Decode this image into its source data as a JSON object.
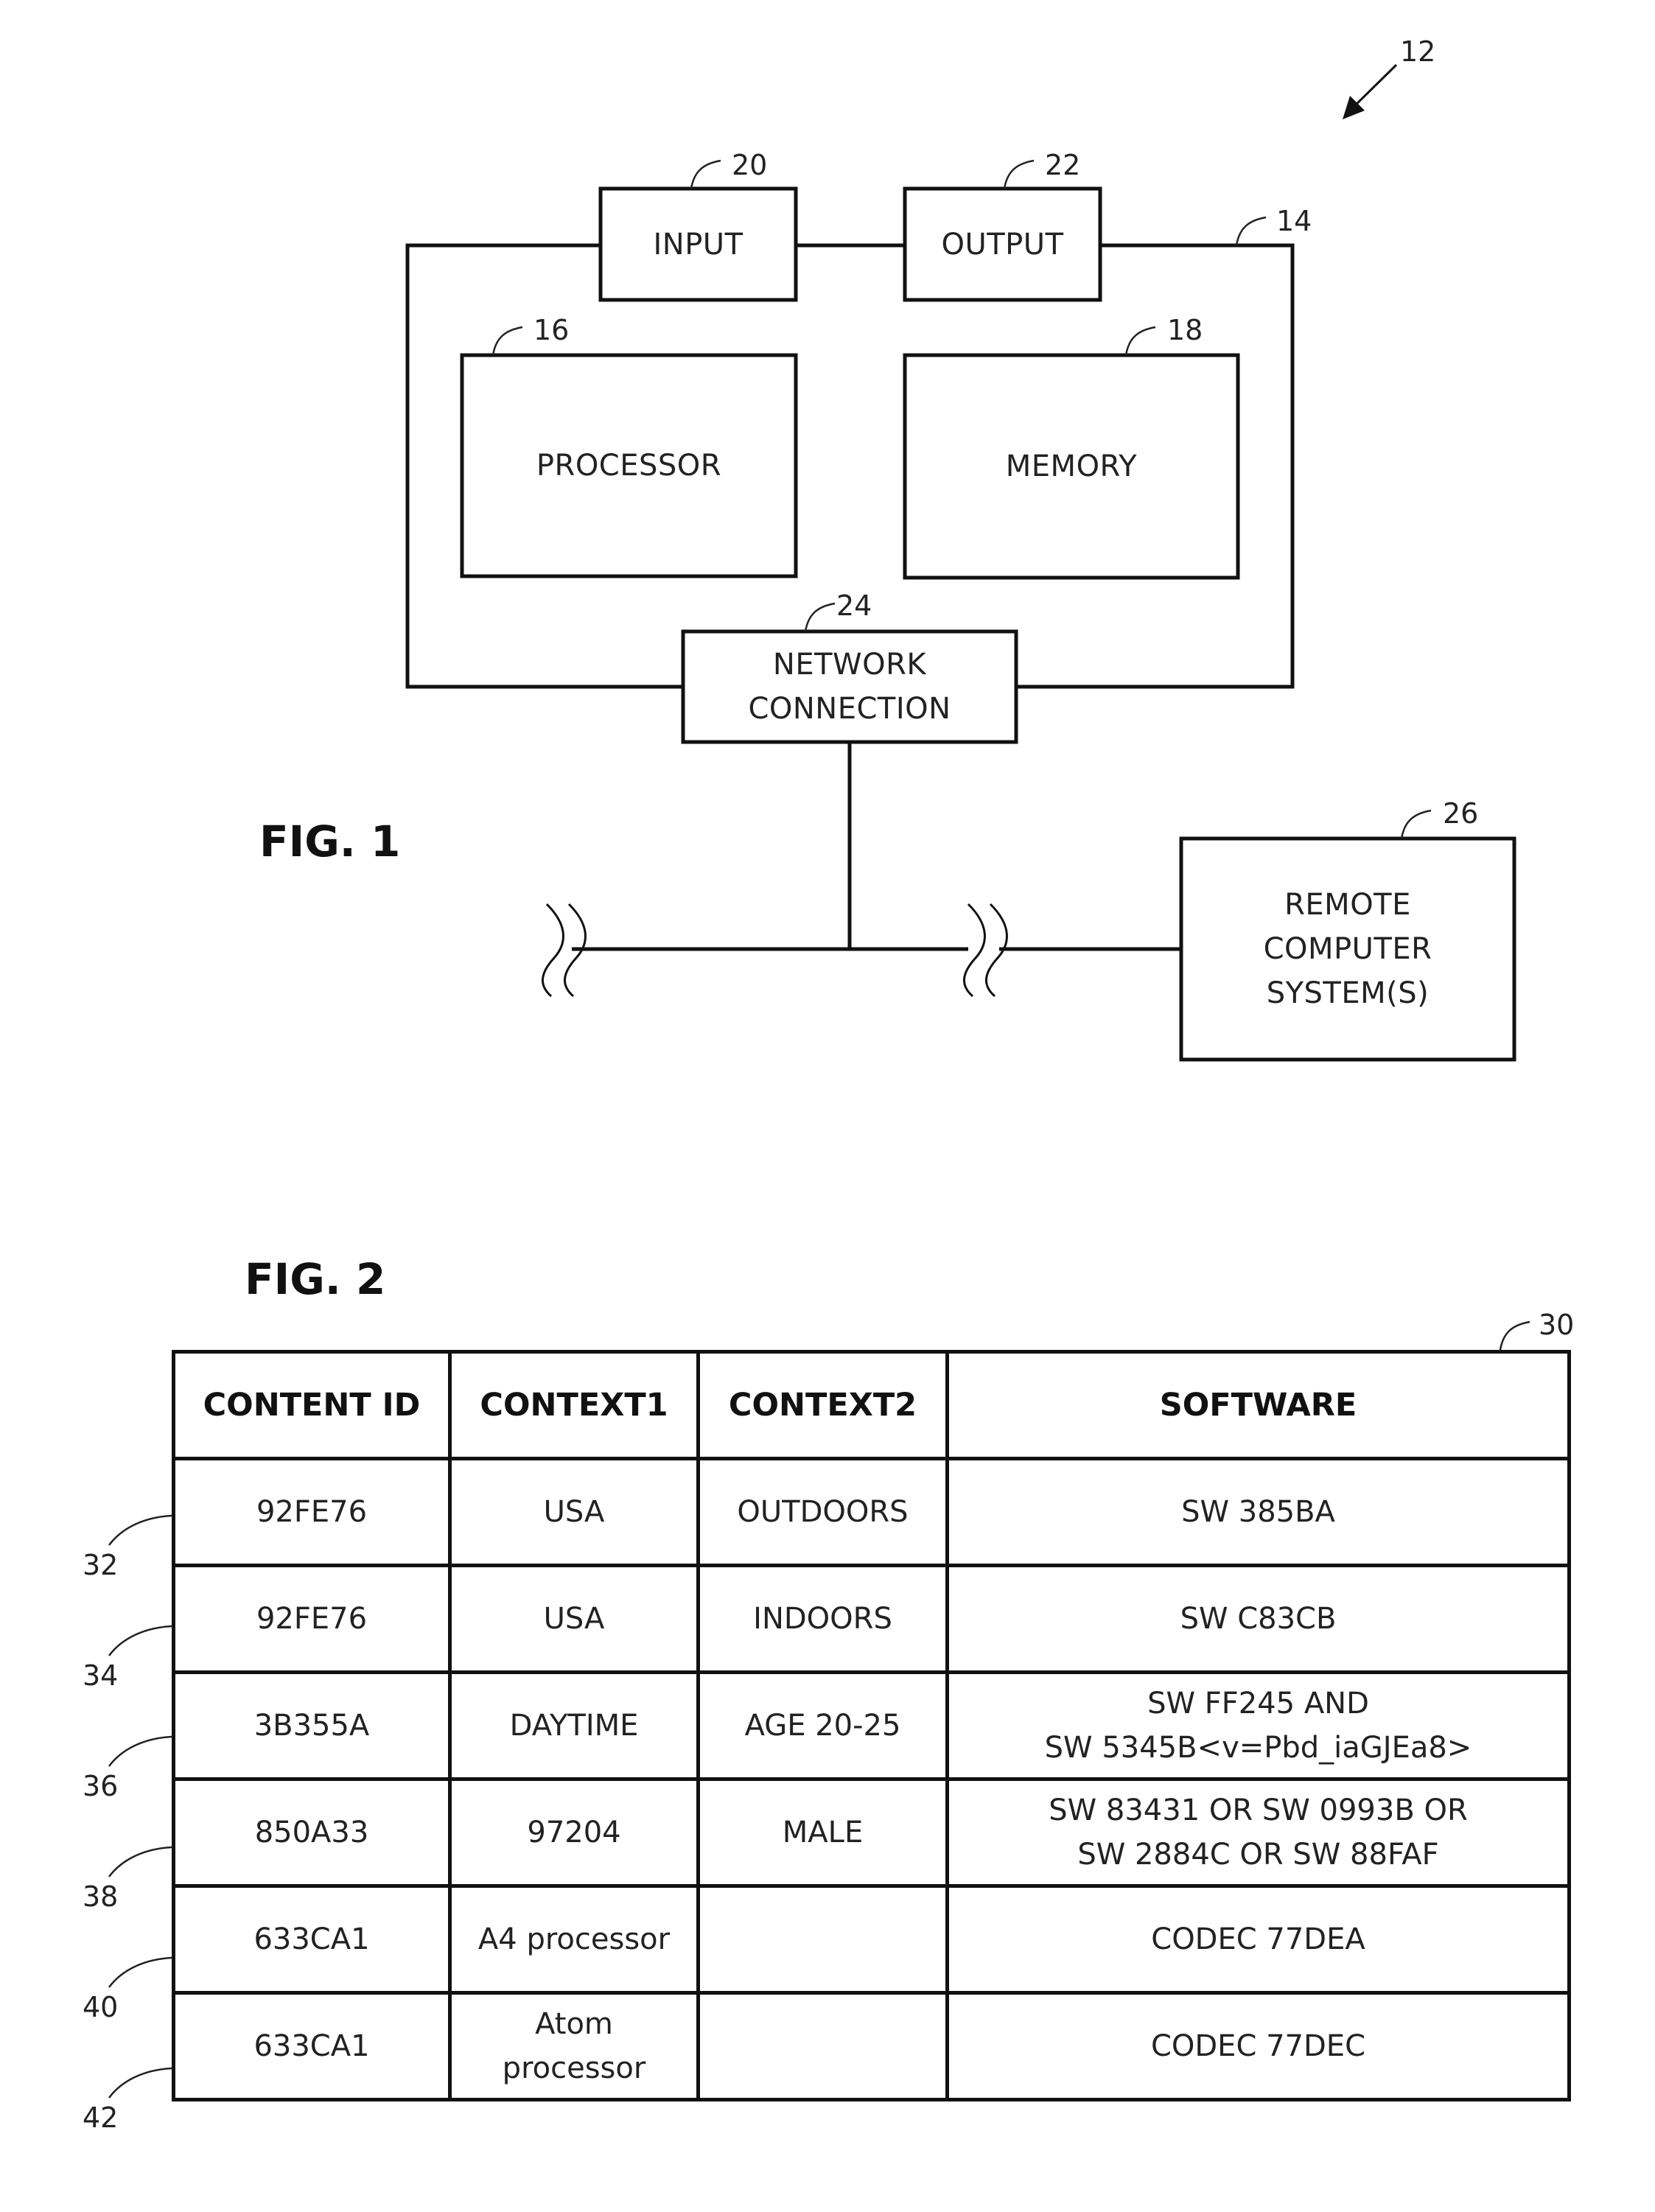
{
  "fig1": {
    "title": "FIG. 1",
    "system_ref": "12",
    "computer_ref": "14",
    "blocks": {
      "input": {
        "label": "INPUT",
        "ref": "20"
      },
      "output": {
        "label": "OUTPUT",
        "ref": "22"
      },
      "processor": {
        "label": "PROCESSOR",
        "ref": "16"
      },
      "memory": {
        "label": "MEMORY",
        "ref": "18"
      },
      "network": {
        "label_line1": "NETWORK",
        "label_line2": "CONNECTION",
        "ref": "24"
      },
      "remote": {
        "label_line1": "REMOTE",
        "label_line2": "COMPUTER",
        "label_line3": "SYSTEM(S)",
        "ref": "26"
      }
    }
  },
  "fig2": {
    "title": "FIG. 2",
    "table_ref": "30",
    "headers": [
      "CONTENT ID",
      "CONTEXT1",
      "CONTEXT2",
      "SOFTWARE"
    ],
    "rows": [
      {
        "ref": "32",
        "cells": [
          "92FE76",
          "USA",
          "OUTDOORS",
          "SW 385BA"
        ]
      },
      {
        "ref": "34",
        "cells": [
          "92FE76",
          "USA",
          "INDOORS",
          "SW C83CB"
        ]
      },
      {
        "ref": "36",
        "cells": [
          "3B355A",
          "DAYTIME",
          "AGE 20-25",
          "SW FF245 AND\nSW 5345B<v=Pbd_iaGJEa8>"
        ]
      },
      {
        "ref": "38",
        "cells": [
          "850A33",
          "97204",
          "MALE",
          "SW 83431 OR SW 0993B OR\nSW 2884C OR SW 88FAF"
        ]
      },
      {
        "ref": "40",
        "cells": [
          "633CA1",
          "A4 processor",
          "",
          "CODEC 77DEA"
        ]
      },
      {
        "ref": "42",
        "cells": [
          "633CA1",
          "Atom\nprocessor",
          "",
          "CODEC 77DEC"
        ]
      }
    ]
  }
}
